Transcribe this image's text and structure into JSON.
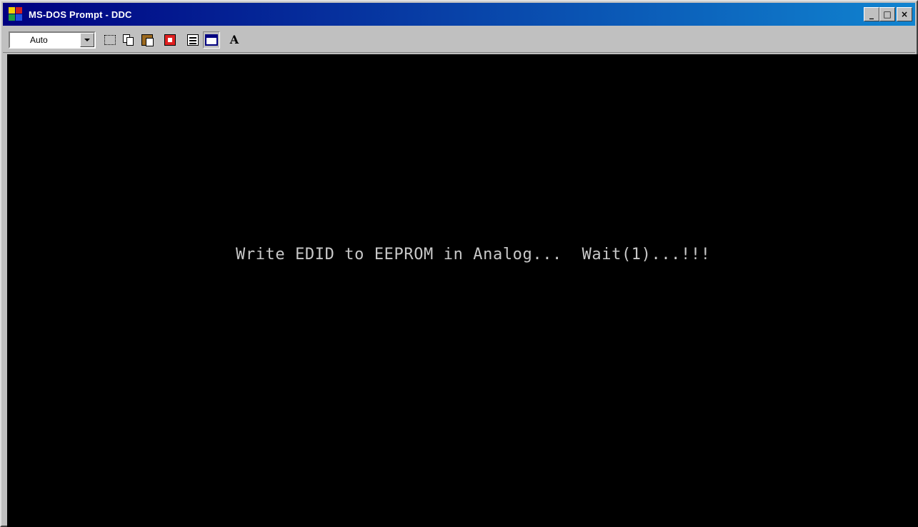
{
  "window": {
    "title": "MS-DOS Prompt - DDC",
    "icon": "msdos-icon",
    "controls": [
      "minimize-icon",
      "maximize-icon",
      "close-icon"
    ],
    "control_glyphs": {
      "minimize": "_",
      "maximize": "□",
      "close": "×"
    }
  },
  "toolbar": {
    "font_size_value": "Auto",
    "buttons": [
      {
        "name": "mark-button",
        "icon": "mark-icon"
      },
      {
        "name": "copy-button",
        "icon": "copy-icon"
      },
      {
        "name": "paste-button",
        "icon": "paste-icon"
      },
      {
        "name": "full-screen-button",
        "icon": "full-screen-icon"
      },
      {
        "name": "properties-button",
        "icon": "properties-icon"
      },
      {
        "name": "background-button",
        "icon": "background-icon"
      },
      {
        "name": "font-button",
        "icon": "font-icon",
        "label": "A"
      }
    ]
  },
  "console": {
    "text": "Write EDID to EEPROM in Analog...  Wait(1)...!!!",
    "background": "#000000",
    "foreground": "#c8c8c8"
  },
  "colors": {
    "titlebar_start": "#000080",
    "titlebar_end": "#1084d0",
    "chrome": "#c0c0c0"
  }
}
